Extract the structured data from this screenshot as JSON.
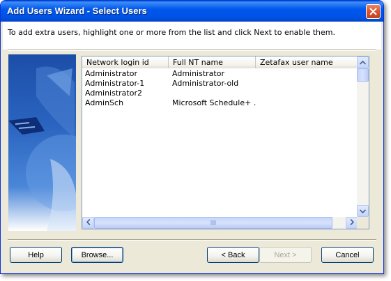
{
  "window": {
    "title": "Add Users Wizard - Select Users"
  },
  "instruction": "To add extra users, highlight one or more from the list and click Next to enable them.",
  "list": {
    "columns": [
      "Network login id",
      "Full NT name",
      "Zetafax user name"
    ],
    "rows": [
      [
        "Administrator",
        "Administrator",
        ""
      ],
      [
        "Administrator-1",
        "Administrator-old",
        ""
      ],
      [
        "Administrator2",
        "",
        ""
      ],
      [
        "AdminSch",
        "Microsoft Schedule+ ...",
        ""
      ]
    ]
  },
  "buttons": {
    "help": "Help",
    "browse": "Browse...",
    "back": "< Back",
    "next": "Next >",
    "cancel": "Cancel"
  },
  "icons": {
    "close": "close-icon",
    "scroll_up": "arrow-up-icon",
    "scroll_down": "arrow-down-icon",
    "scroll_left": "arrow-left-icon",
    "scroll_right": "arrow-right-icon",
    "banner": "wizard-banner-graphic"
  },
  "colors": {
    "titlebar": "#0058ee",
    "dialog_bg": "#ece9d8",
    "close_button": "#d8552e"
  }
}
